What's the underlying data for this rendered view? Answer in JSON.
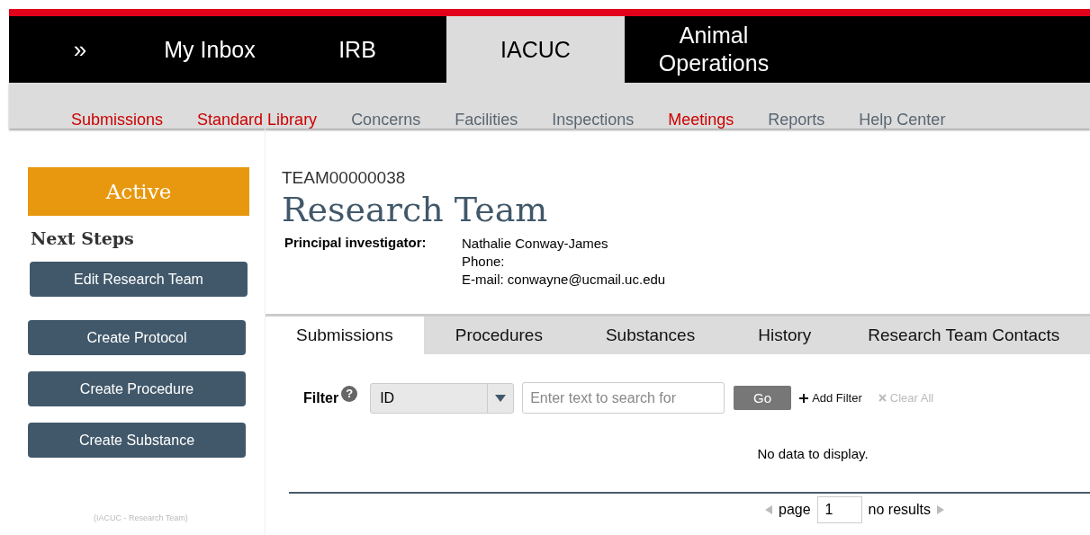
{
  "nav": {
    "expand_glyph": "»",
    "items": [
      {
        "label": "My Inbox",
        "selected": false
      },
      {
        "label": "IRB",
        "selected": false
      },
      {
        "label": "IACUC",
        "selected": true
      },
      {
        "label": "Animal Operations",
        "selected": false
      }
    ]
  },
  "subnav": [
    {
      "label": "Submissions",
      "color": "#cc0000"
    },
    {
      "label": "Standard Library",
      "color": "#cc0000"
    },
    {
      "label": "Concerns",
      "color": "#5a6672"
    },
    {
      "label": "Facilities",
      "color": "#5a6672"
    },
    {
      "label": "Inspections",
      "color": "#5a6672"
    },
    {
      "label": "Meetings",
      "color": "#cc0000"
    },
    {
      "label": "Reports",
      "color": "#5a6672"
    },
    {
      "label": "Help Center",
      "color": "#5a6672"
    }
  ],
  "sidebar": {
    "status": "Active",
    "next_steps_title": "Next Steps",
    "actions": [
      "Edit Research Team",
      "Create Protocol",
      "Create Procedure",
      "Create Substance"
    ],
    "footer": "(IACUC - Research Team)"
  },
  "record": {
    "id": "TEAM00000038",
    "title": "Research Team",
    "pi_label": "Principal investigator:",
    "pi_lines": [
      "Nathalie Conway-James",
      "Phone:",
      "E-mail: conwayne@ucmail.uc.edu"
    ]
  },
  "tabs": [
    {
      "label": "Submissions",
      "selected": true
    },
    {
      "label": "Procedures",
      "selected": false
    },
    {
      "label": "Substances",
      "selected": false
    },
    {
      "label": "History",
      "selected": false
    },
    {
      "label": "Research Team Contacts",
      "selected": false
    }
  ],
  "filter": {
    "label": "Filter",
    "help_glyph": "?",
    "field": "ID",
    "placeholder": "Enter text to search for",
    "go": "Go",
    "add": "Add Filter",
    "clear": "Clear All"
  },
  "empty_message": "No data to display.",
  "pager": {
    "label": "page",
    "value": "1",
    "results": "no results"
  }
}
